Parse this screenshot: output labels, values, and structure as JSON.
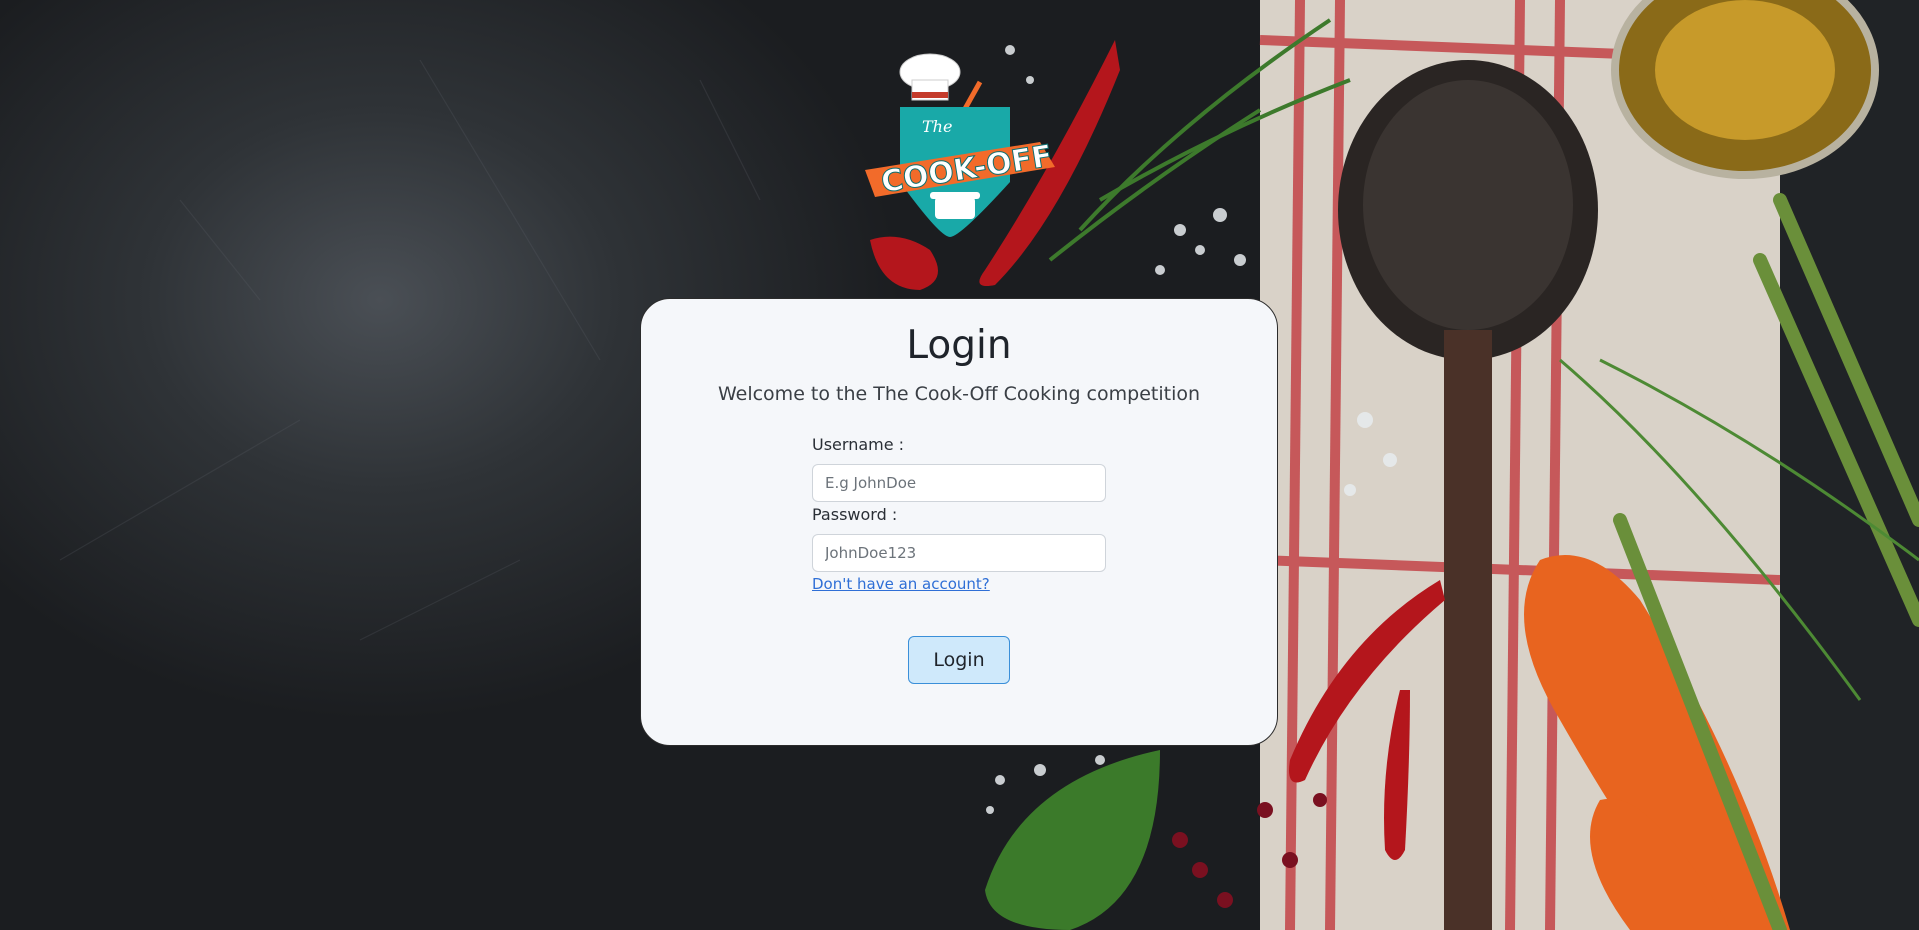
{
  "logo": {
    "top_text": "The",
    "main_text": "COOK-OFF",
    "icon": "chef-hat-pot-logo"
  },
  "login_card": {
    "title": "Login",
    "subtitle": "Welcome to the The Cook-Off Cooking competition",
    "username": {
      "label": "Username :",
      "value": "",
      "placeholder": "E.g JohnDoe"
    },
    "password": {
      "label": "Password :",
      "value": "",
      "placeholder": "JohnDoe123"
    },
    "signup_link": "Don't have an account?",
    "submit_label": "Login"
  },
  "colors": {
    "card_bg": "#f5f7fa",
    "button_bg": "#cfe9fb",
    "button_border": "#3a8fd9",
    "link": "#2f6fd6",
    "logo_teal": "#19a9a8",
    "logo_orange": "#f26b2a"
  }
}
